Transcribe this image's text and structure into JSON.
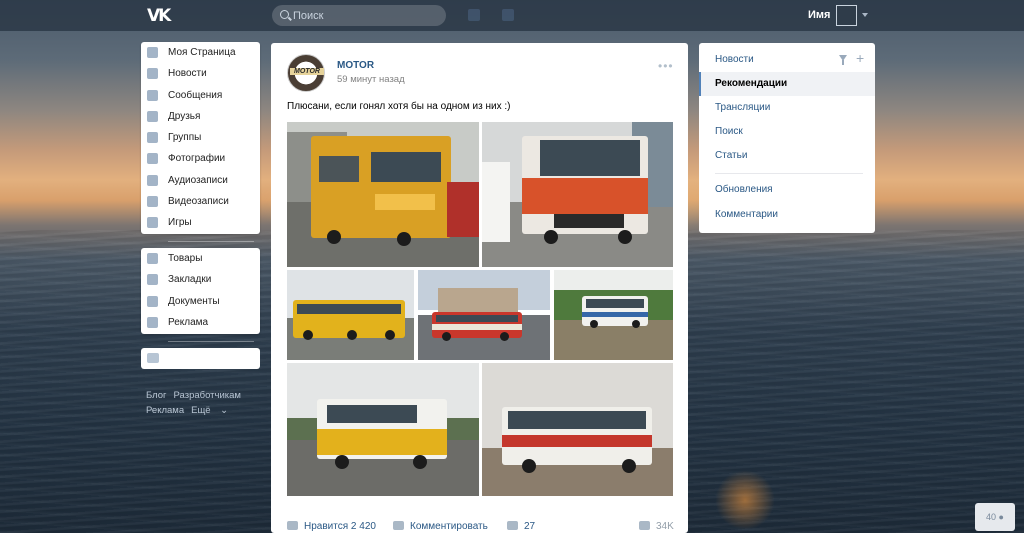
{
  "topbar": {
    "search_placeholder": "Поиск",
    "username": "Имя"
  },
  "left_menu": {
    "main": [
      {
        "label": "Моя Страница",
        "icon": "home-icon"
      },
      {
        "label": "Новости",
        "icon": "news-icon"
      },
      {
        "label": "Сообщения",
        "icon": "messages-icon"
      },
      {
        "label": "Друзья",
        "icon": "friend-icon"
      },
      {
        "label": "Группы",
        "icon": "groups-icon"
      },
      {
        "label": "Фотографии",
        "icon": "camera-icon"
      },
      {
        "label": "Аудиозаписи",
        "icon": "music-note-icon"
      },
      {
        "label": "Видеозаписи",
        "icon": "film-icon"
      },
      {
        "label": "Игры",
        "icon": "gamepad-icon"
      }
    ],
    "secondary": [
      {
        "label": "Товары",
        "icon": "bag-icon"
      },
      {
        "label": "Закладки",
        "icon": "star-icon"
      },
      {
        "label": "Документы",
        "icon": "document-icon"
      },
      {
        "label": "Реклама",
        "icon": "megaphone-icon"
      }
    ],
    "footer": {
      "blog": "Блог",
      "developers": "Разработчикам",
      "ads": "Реклама",
      "more": "Ещё"
    }
  },
  "post": {
    "author": "MOTOR",
    "avatar_text": "MOTOR",
    "time": "59 минут назад",
    "text": "Плюсани, если гонял хотя бы на одном из них :)",
    "likes_label": "Нравится",
    "likes_count": "2 420",
    "comment_label": "Комментировать",
    "shares_count": "27",
    "views_count": "34K"
  },
  "right_menu": {
    "items": [
      {
        "label": "Новости",
        "active": false
      },
      {
        "label": "Рекомендации",
        "active": true
      },
      {
        "label": "Трансляции",
        "active": false
      },
      {
        "label": "Поиск",
        "active": false
      },
      {
        "label": "Статьи",
        "active": false
      }
    ],
    "items2": [
      {
        "label": "Обновления"
      },
      {
        "label": "Комментарии"
      }
    ]
  },
  "online": {
    "count": "40"
  },
  "colors": {
    "vk_blue": "#5181b8",
    "link": "#2a5885",
    "topbar": "#2f3c4a"
  }
}
